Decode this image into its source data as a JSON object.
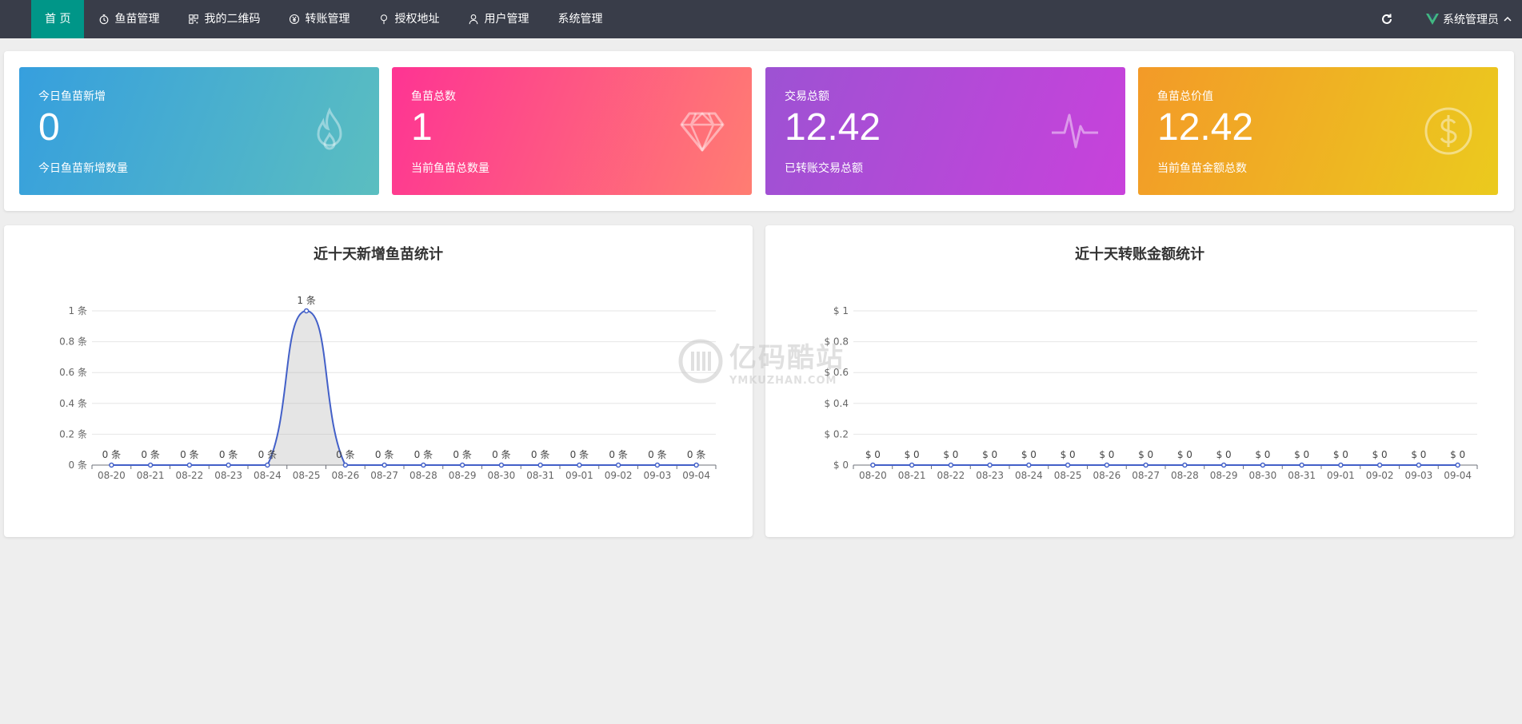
{
  "nav": {
    "items": [
      {
        "label": "首 页",
        "icon": ""
      },
      {
        "label": "鱼苗管理",
        "icon": "timer-icon"
      },
      {
        "label": "我的二维码",
        "icon": "qrcode-icon"
      },
      {
        "label": "转账管理",
        "icon": "yen-icon"
      },
      {
        "label": "授权地址",
        "icon": "location-icon"
      },
      {
        "label": "用户管理",
        "icon": "user-icon"
      },
      {
        "label": "系统管理",
        "icon": ""
      }
    ],
    "user_name": "系统管理员"
  },
  "cards": [
    {
      "title": "今日鱼苗新增",
      "value": "0",
      "desc": "今日鱼苗新增数量",
      "icon": "fire-icon",
      "colors": [
        "#369fde",
        "#5bbec0"
      ]
    },
    {
      "title": "鱼苗总数",
      "value": "1",
      "desc": "当前鱼苗总数量",
      "icon": "diamond-icon",
      "colors": [
        "#fe3493",
        "#ff7d72"
      ]
    },
    {
      "title": "交易总额",
      "value": "12.42",
      "desc": "已转账交易总额",
      "icon": "pulse-icon",
      "colors": [
        "#9d52d3",
        "#c842db"
      ]
    },
    {
      "title": "鱼苗总价值",
      "value": "12.42",
      "desc": "当前鱼苗金额总数",
      "icon": "dollar-icon",
      "colors": [
        "#f39a28",
        "#ebca1e"
      ]
    }
  ],
  "watermark": {
    "main": "亿码酷站",
    "sub": "YMKUZHAN.COM"
  },
  "chart_data": [
    {
      "type": "area",
      "title": "近十天新增鱼苗统计",
      "categories": [
        "08-20",
        "08-21",
        "08-22",
        "08-23",
        "08-24",
        "08-25",
        "08-26",
        "08-27",
        "08-28",
        "08-29",
        "08-30",
        "08-31",
        "09-01",
        "09-02",
        "09-03",
        "09-04"
      ],
      "values": [
        0,
        0,
        0,
        0,
        0,
        1,
        0,
        0,
        0,
        0,
        0,
        0,
        0,
        0,
        0,
        0
      ],
      "ylim": [
        0,
        1
      ],
      "yticks": [
        0,
        0.2,
        0.4,
        0.6,
        0.8,
        1
      ],
      "y_prefix": "",
      "y_suffix": " 条",
      "grid": true,
      "line_color": "#4360c8"
    },
    {
      "type": "line",
      "title": "近十天转账金额统计",
      "categories": [
        "08-20",
        "08-21",
        "08-22",
        "08-23",
        "08-24",
        "08-25",
        "08-26",
        "08-27",
        "08-28",
        "08-29",
        "08-30",
        "08-31",
        "09-01",
        "09-02",
        "09-03",
        "09-04"
      ],
      "values": [
        0,
        0,
        0,
        0,
        0,
        0,
        0,
        0,
        0,
        0,
        0,
        0,
        0,
        0,
        0,
        0
      ],
      "ylim": [
        0,
        1
      ],
      "yticks": [
        0,
        0.2,
        0.4,
        0.6,
        0.8,
        1
      ],
      "y_prefix": "$ ",
      "y_suffix": "",
      "grid": true,
      "line_color": "#4360c8"
    }
  ]
}
